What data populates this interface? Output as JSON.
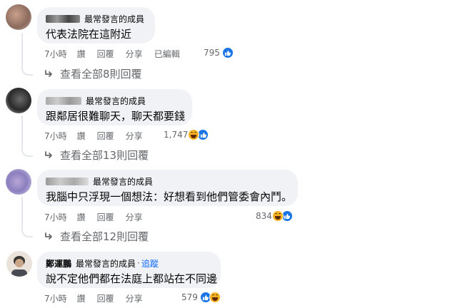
{
  "badge": "最常發言的成員",
  "actions": {
    "time": "7小時",
    "like": "讚",
    "reply": "回覆",
    "share": "分享",
    "edited": "已編輯"
  },
  "comments": [
    {
      "text": "代表法院在這附近",
      "count": "795",
      "reactions": [
        "like-icon"
      ],
      "view_replies": "查看全部8則回覆"
    },
    {
      "text": "跟鄰居很難聊天，聊天都要錢",
      "count": "1,747",
      "reactions": [
        "haha-icon",
        "like-icon"
      ],
      "view_replies": "查看全部13則回覆"
    },
    {
      "text": "我腦中只浮現一個想法：好想看到他們管委會內鬥。",
      "count": "834",
      "reactions": [
        "haha-icon",
        "like-icon"
      ],
      "view_replies": "查看全部12則回覆"
    },
    {
      "author": "鄭運鵬",
      "follow": "追蹤",
      "text": "說不定他們都在法庭上都站在不同邊",
      "count": "579",
      "reactions": [
        "like-icon",
        "haha-icon"
      ]
    }
  ]
}
